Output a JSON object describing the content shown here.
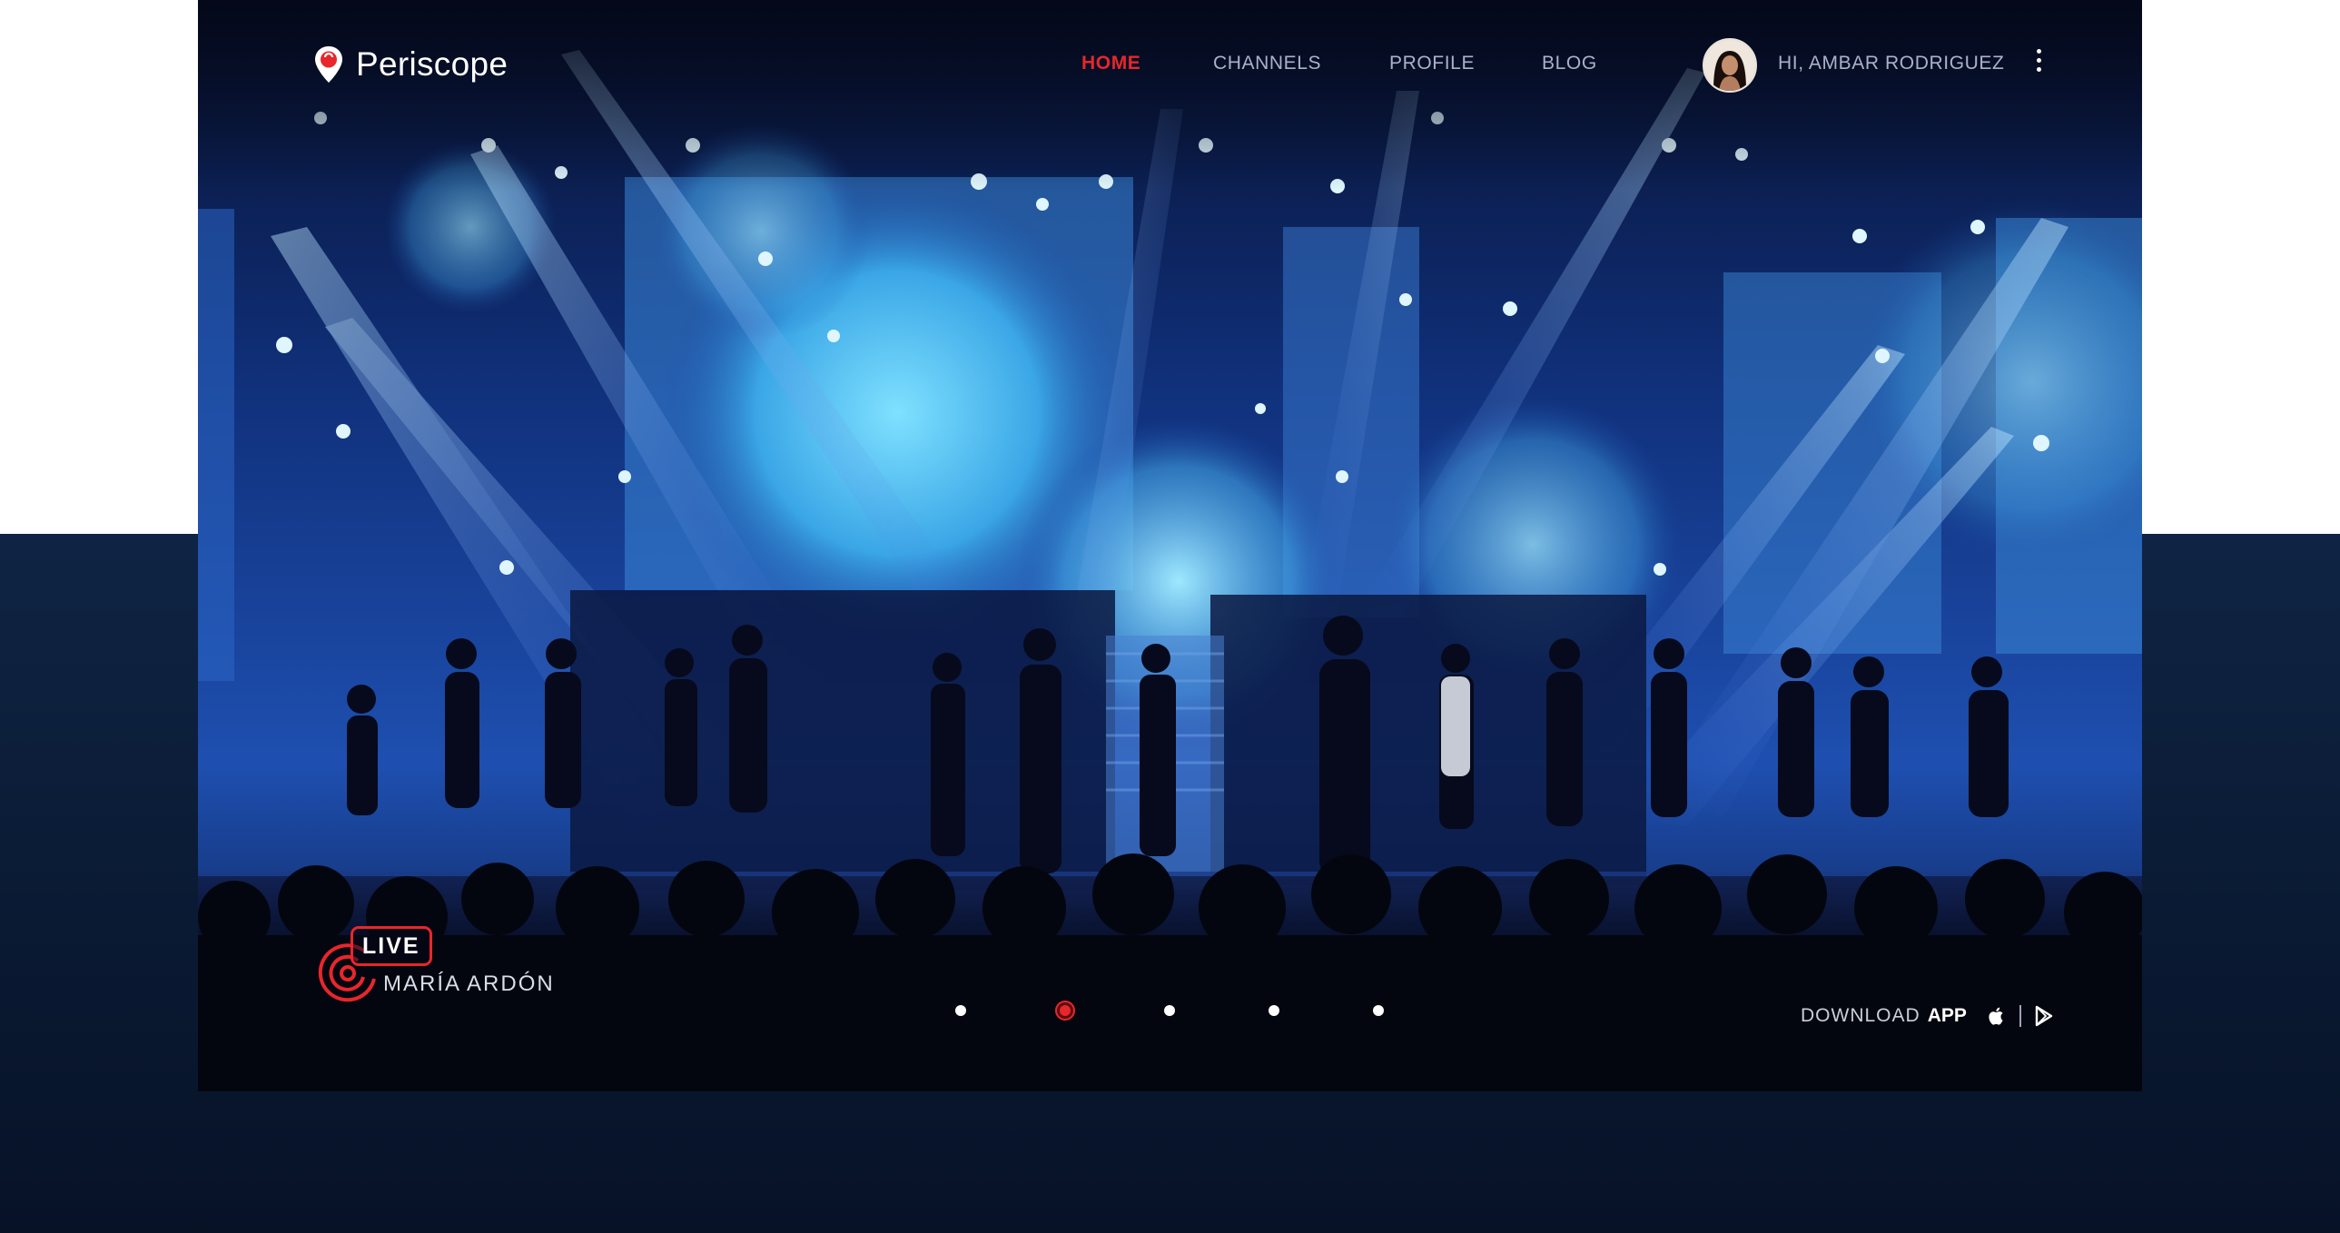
{
  "brand": {
    "name": "Periscope",
    "logo_icon": "periscope-pin-icon",
    "accent": "#e8262b"
  },
  "nav": {
    "items": [
      {
        "label": "HOME",
        "active": true
      },
      {
        "label": "CHANNELS",
        "active": false
      },
      {
        "label": "PROFILE",
        "active": false
      },
      {
        "label": "BLOG",
        "active": false
      }
    ]
  },
  "user": {
    "greeting": "HI, AMBAR RODRIGUEZ",
    "avatar_icon": "user-avatar",
    "menu_icon": "kebab-menu-icon"
  },
  "hero": {
    "live_label": "LIVE",
    "broadcaster": "MARÍA ARDÓN",
    "live_icon": "broadcast-signal-icon"
  },
  "carousel": {
    "total": 5,
    "active_index": 1
  },
  "download": {
    "prefix": "DOWNLOAD",
    "strong": "APP",
    "icons": [
      "apple-icon",
      "google-play-icon"
    ]
  },
  "colors": {
    "page_bottom": "#0f2444",
    "nav_text": "#aab2c9",
    "active": "#e8262b"
  }
}
